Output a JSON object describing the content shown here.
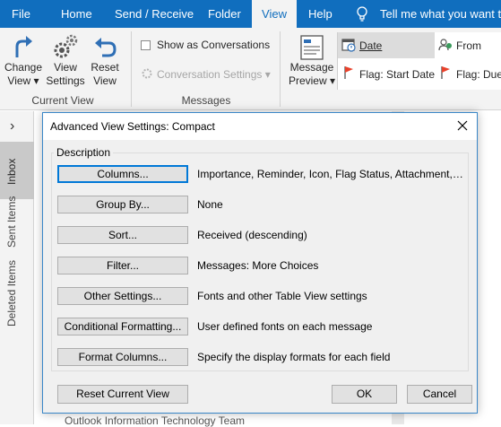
{
  "ribbon": {
    "tabs": [
      {
        "label": "File"
      },
      {
        "label": "Home"
      },
      {
        "label": "Send / Receive"
      },
      {
        "label": "Folder"
      },
      {
        "label": "View"
      },
      {
        "label": "Help"
      }
    ],
    "tell_me": "Tell me what you want to",
    "current_view": {
      "change_view": [
        "Change",
        "View ▾"
      ],
      "view_settings": [
        "View",
        "Settings"
      ],
      "reset_view": [
        "Reset",
        "View"
      ],
      "group_label": "Current View"
    },
    "messages": {
      "show_as_conversations": "Show as Conversations",
      "conversation_settings": "Conversation Settings ▾",
      "group_label": "Messages"
    },
    "message_preview": [
      "Message",
      "Preview ▾"
    ],
    "arrangement": {
      "date": "Date",
      "from": "From",
      "flag_start": "Flag: Start Date",
      "flag_due": "Flag: Due"
    }
  },
  "nav": {
    "expand_glyph": "›",
    "folders": [
      "Inbox",
      "Sent Items",
      "Deleted Items"
    ]
  },
  "background_peek": "Outlook Information Technology Team",
  "dialog": {
    "title": "Advanced View Settings: Compact",
    "group_caption": "Description",
    "rows": [
      {
        "button": "Columns...",
        "description": "Importance, Reminder, Icon, Flag Status, Attachment, Fr..."
      },
      {
        "button": "Group By...",
        "description": "None"
      },
      {
        "button": "Sort...",
        "description": "Received (descending)"
      },
      {
        "button": "Filter...",
        "description": "Messages: More Choices"
      },
      {
        "button": "Other Settings...",
        "description": "Fonts and other Table View settings"
      },
      {
        "button": "Conditional Formatting...",
        "description": "User defined fonts on each message"
      },
      {
        "button": "Format Columns...",
        "description": "Specify the display formats for each field"
      }
    ],
    "reset_button": "Reset Current View",
    "ok_button": "OK",
    "cancel_button": "Cancel"
  },
  "colors": {
    "accent": "#106ebe",
    "flag": "#e8412b"
  }
}
